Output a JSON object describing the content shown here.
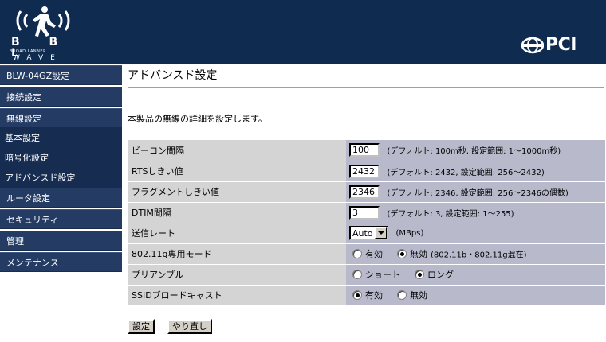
{
  "header": {
    "logo_letters": "B B L",
    "logo_subtitle": "BROAD LANNER",
    "logo_wave": "WAVE",
    "brand": "PCI"
  },
  "sidebar": {
    "items": [
      {
        "label": "BLW-04GZ設定"
      },
      {
        "label": "接続設定"
      },
      {
        "label": "無線設定"
      }
    ],
    "subitems": [
      {
        "label": "基本設定"
      },
      {
        "label": "暗号化設定"
      },
      {
        "label": "アドバンスド設定"
      }
    ],
    "items_after": [
      {
        "label": "ルータ設定"
      },
      {
        "label": "セキュリティ"
      },
      {
        "label": "管理"
      },
      {
        "label": "メンテナンス"
      }
    ]
  },
  "main": {
    "title": "アドバンスド設定",
    "description": "本製品の無線の詳細を設定します。",
    "rows": {
      "beacon": {
        "label": "ビーコン間隔",
        "value": "100",
        "hint": "(デフォルト: 100m秒, 設定範囲: 1〜1000m秒)"
      },
      "rts": {
        "label": "RTSしきい値",
        "value": "2432",
        "hint": "(デフォルト: 2432, 設定範囲: 256〜2432)"
      },
      "frag": {
        "label": "フラグメントしきい値",
        "value": "2346",
        "hint": "(デフォルト: 2346, 設定範囲: 256〜2346の偶数)"
      },
      "dtim": {
        "label": "DTIM間隔",
        "value": "3",
        "hint": "(デフォルト: 3, 設定範囲: 1〜255)"
      },
      "rate": {
        "label": "送信レート",
        "selected": "Auto",
        "unit": "(MBps)"
      },
      "g_only": {
        "label": "802.11g専用モード",
        "opt1": "有効",
        "opt2": "無効",
        "note": "(802.11b・802.11g混在)",
        "selected": "無効"
      },
      "preamble": {
        "label": "プリアンブル",
        "opt1": "ショート",
        "opt2": "ロング",
        "selected": "ロング"
      },
      "ssid_broadcast": {
        "label": "SSIDブロードキャスト",
        "opt1": "有効",
        "opt2": "無効",
        "selected": "有効"
      }
    },
    "buttons": {
      "apply": "設定",
      "reset": "やり直し"
    }
  }
}
